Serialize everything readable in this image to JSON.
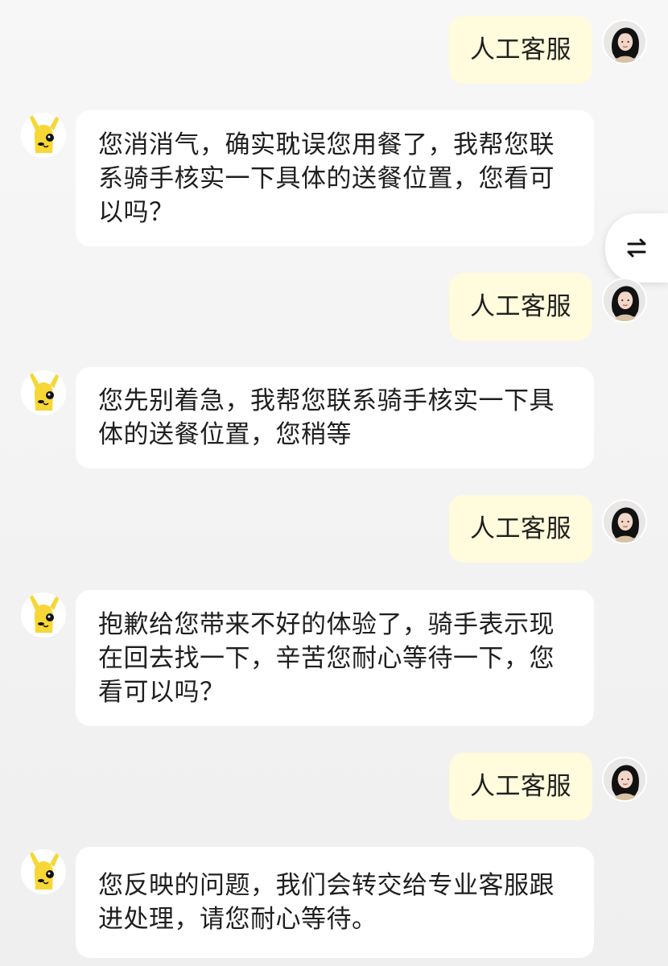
{
  "messages": [
    {
      "role": "user",
      "text": "人工客服"
    },
    {
      "role": "bot",
      "text": "您消消气，确实耽误您用餐了，我帮您联系骑手核实一下具体的送餐位置，您看可以吗？"
    },
    {
      "role": "user",
      "text": "人工客服"
    },
    {
      "role": "bot",
      "text": "您先别着急，我帮您联系骑手核实一下具体的送餐位置，您稍等"
    },
    {
      "role": "user",
      "text": "人工客服"
    },
    {
      "role": "bot",
      "text": "抱歉给您带来不好的体验了，骑手表示现在回去找一下，辛苦您耐心等待一下，您看可以吗？"
    },
    {
      "role": "user",
      "text": "人工客服"
    },
    {
      "role": "bot",
      "text": "您反映的问题，我们会转交给专业客服跟进处理，请您耐心等待。"
    }
  ],
  "icons": {
    "user_avatar": "user-avatar-icon",
    "bot_avatar": "yellow-dog-icon",
    "side_action": "swap-icon"
  },
  "colors": {
    "user_bubble": "#fffbdc",
    "bot_bubble": "#ffffff",
    "background": "#f2f2f2",
    "bot_avatar": "#f6d735"
  }
}
